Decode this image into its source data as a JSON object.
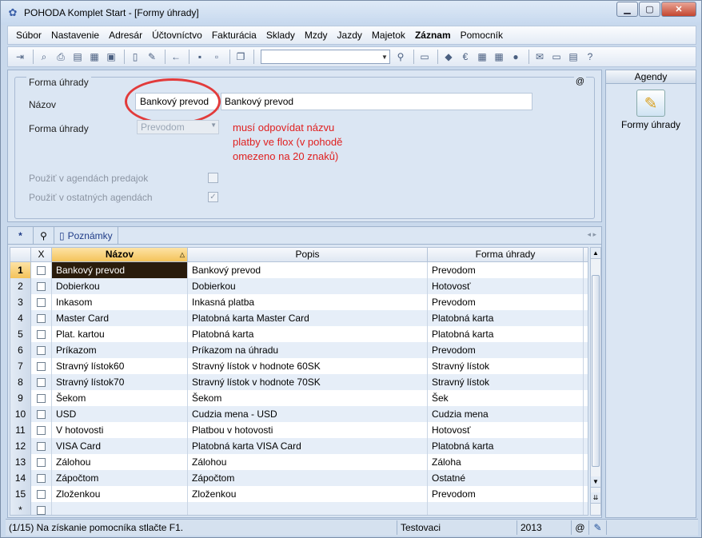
{
  "window": {
    "title": "POHODA Komplet Start - [Formy úhrady]"
  },
  "menu": [
    "Súbor",
    "Nastavenie",
    "Adresár",
    "Účtovníctvo",
    "Fakturácia",
    "Sklady",
    "Mzdy",
    "Jazdy",
    "Majetok",
    "Záznam",
    "Pomocník"
  ],
  "form": {
    "group_title": "Forma úhrady",
    "at_symbol": "@",
    "nazov_label": "Názov",
    "nazov_short": "Bankový prevod",
    "nazov_long": "Bankový prevod",
    "forma_label": "Forma úhrady",
    "forma_value": "Prevodom",
    "use_sales_label": "Použiť v agendách predajok",
    "use_other_label": "Použiť v ostatných agendách",
    "use_other_checked": true,
    "annotation": "musí odpovídat názvu platby ve flox (v pohodě omezeno na 20 znaků)"
  },
  "agendy": {
    "header": "Agendy",
    "item": "Formy úhrady"
  },
  "tabs": {
    "star": "*",
    "notes": "Poznámky"
  },
  "grid": {
    "columns": {
      "x": "X",
      "nazov": "Názov",
      "popis": "Popis",
      "forma": "Forma úhrady"
    },
    "rows": [
      {
        "n": "1",
        "nazov": "Bankový prevod",
        "popis": "Bankový prevod",
        "forma": "Prevodom"
      },
      {
        "n": "2",
        "nazov": "Dobierkou",
        "popis": "Dobierkou",
        "forma": "Hotovosť"
      },
      {
        "n": "3",
        "nazov": "Inkasom",
        "popis": "Inkasná platba",
        "forma": "Prevodom"
      },
      {
        "n": "4",
        "nazov": "Master Card",
        "popis": "Platobná karta Master Card",
        "forma": "Platobná karta"
      },
      {
        "n": "5",
        "nazov": "Plat. kartou",
        "popis": "Platobná karta",
        "forma": "Platobná karta"
      },
      {
        "n": "6",
        "nazov": "Príkazom",
        "popis": "Príkazom na úhradu",
        "forma": "Prevodom"
      },
      {
        "n": "7",
        "nazov": "Stravný lístok60",
        "popis": "Stravný lístok v hodnote 60SK",
        "forma": "Stravný lístok"
      },
      {
        "n": "8",
        "nazov": "Stravný lístok70",
        "popis": "Stravný lístok v hodnote 70SK",
        "forma": "Stravný lístok"
      },
      {
        "n": "9",
        "nazov": "Šekom",
        "popis": "Šekom",
        "forma": "Šek"
      },
      {
        "n": "10",
        "nazov": "USD",
        "popis": "Cudzia mena - USD",
        "forma": "Cudzia mena"
      },
      {
        "n": "11",
        "nazov": "V hotovosti",
        "popis": "Platbou v hotovosti",
        "forma": "Hotovosť"
      },
      {
        "n": "12",
        "nazov": "VISA Card",
        "popis": "Platobná karta VISA Card",
        "forma": "Platobná karta"
      },
      {
        "n": "13",
        "nazov": "Zálohou",
        "popis": "Zálohou",
        "forma": "Záloha"
      },
      {
        "n": "14",
        "nazov": "Zápočtom",
        "popis": "Zápočtom",
        "forma": "Ostatné"
      },
      {
        "n": "15",
        "nazov": "Zloženkou",
        "popis": "Zloženkou",
        "forma": "Prevodom"
      }
    ],
    "new_row_marker": "*"
  },
  "status": {
    "hint": "(1/15) Na získanie pomocníka stlačte F1.",
    "user": "Testovaci",
    "year": "2013",
    "at": "@"
  }
}
